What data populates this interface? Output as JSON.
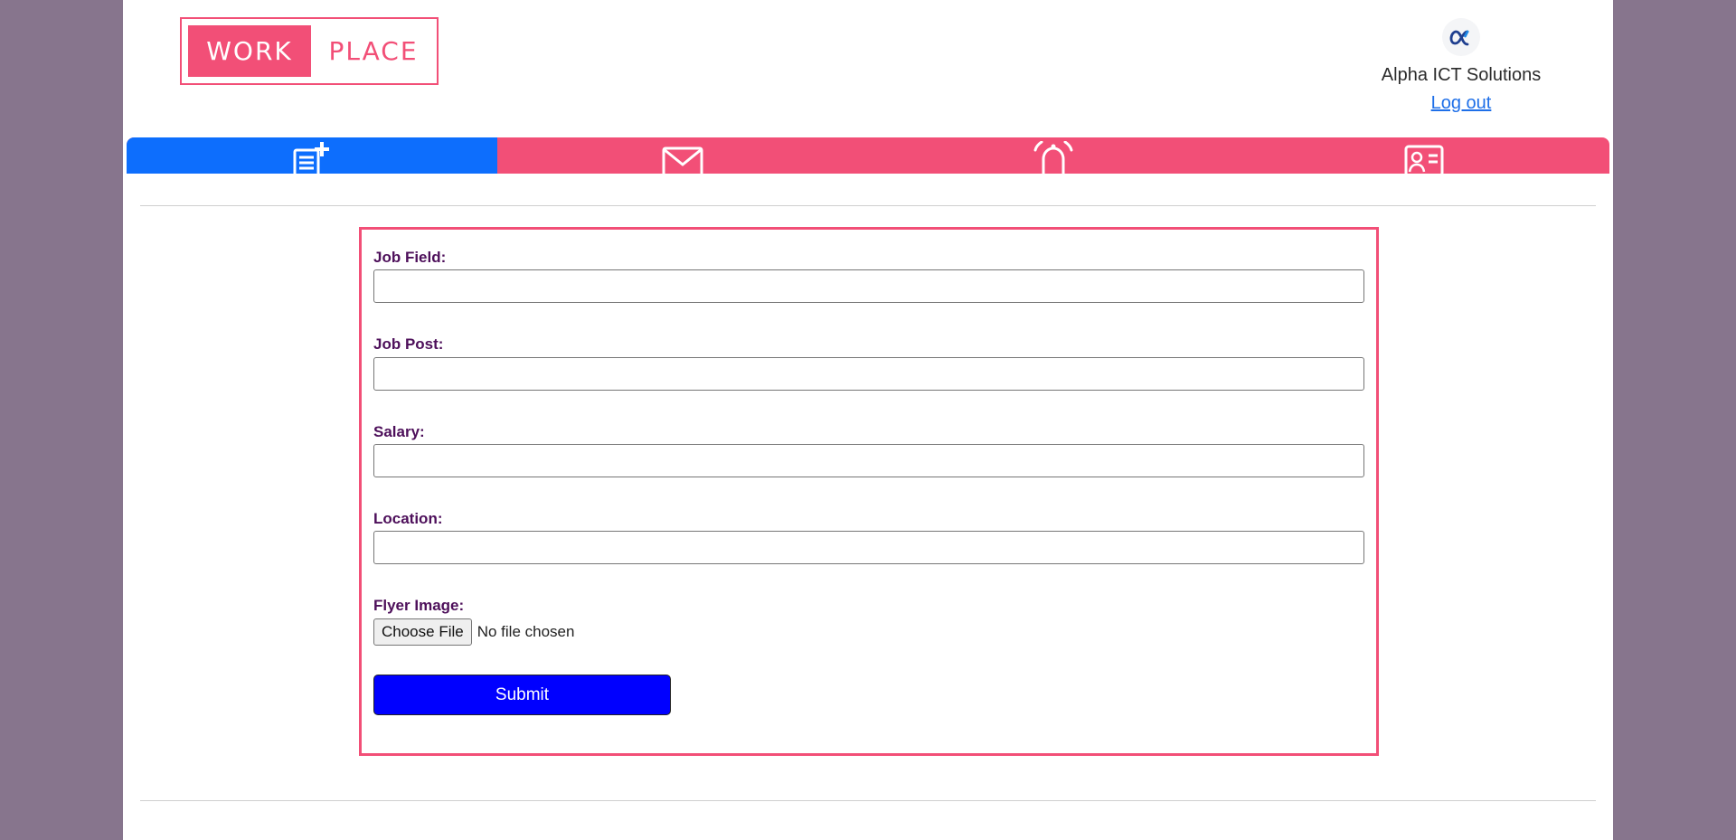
{
  "header": {
    "logo_left": "WORK",
    "logo_right": "PLACE",
    "company_name": "Alpha ICT Solutions",
    "logout_label": "Log out"
  },
  "tabs": [
    {
      "icon": "post-add-icon",
      "active": true
    },
    {
      "icon": "envelope-icon",
      "active": false
    },
    {
      "icon": "bell-icon",
      "active": false
    },
    {
      "icon": "profile-card-icon",
      "active": false
    }
  ],
  "form": {
    "job_field_label": "Job Field:",
    "job_field_value": "",
    "job_post_label": "Job Post:",
    "job_post_value": "",
    "salary_label": "Salary:",
    "salary_value": "",
    "location_label": "Location:",
    "location_value": "",
    "flyer_label": "Flyer Image:",
    "file_button_label": "Choose File",
    "file_status": "No file chosen",
    "submit_label": "Submit"
  },
  "colors": {
    "background": "#87758d",
    "brand_pink": "#f24f77",
    "active_tab": "#0d6efd",
    "label_purple": "#4d0f5a",
    "submit_blue": "#0000ff"
  }
}
